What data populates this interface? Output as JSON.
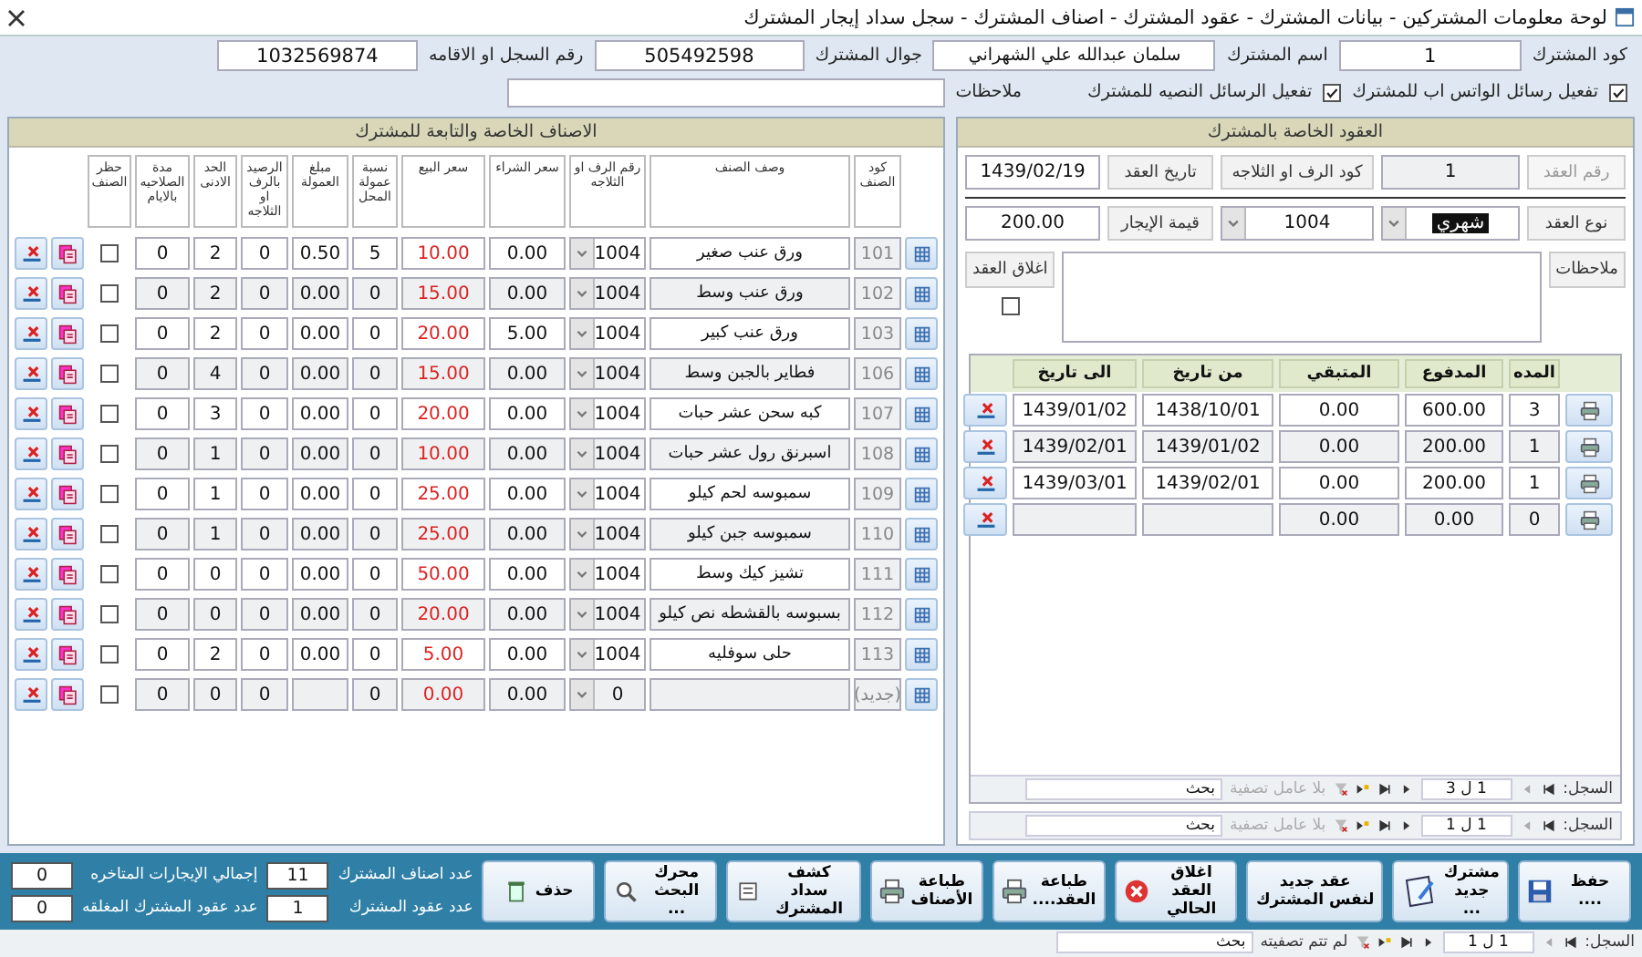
{
  "window": {
    "title": "لوحة معلومات المشتركين - بيانات المشترك - عقود المشترك - اصناف المشترك - سجل سداد إيجار المشترك"
  },
  "subscriber": {
    "fields": [
      {
        "label": "كود المشترك",
        "value": "1"
      },
      {
        "label": "اسم المشترك",
        "value": "سلمان عبدالله علي الشهراني"
      },
      {
        "label": "جوال المشترك",
        "value": "505492598"
      },
      {
        "label": "رقم السجل او الاقامه",
        "value": "1032569874"
      }
    ],
    "whatsapp": {
      "label": "تفعيل رسائل الواتس اب للمشترك",
      "checked": true
    },
    "sms": {
      "label": "تفعيل الرسائل النصيه للمشترك",
      "checked": true
    },
    "notes": {
      "label": "ملاحظات"
    }
  },
  "items_panel": {
    "title": "الاصناف الخاصة والتابعة للمشترك",
    "columns": [
      "كود الصنف",
      "وصف الصنف",
      "رقم الرف او الثلاجه",
      "سعر الشراء",
      "سعر البيع",
      "نسبة عمولة المحل",
      "مبلغ العمولة",
      "الرصيد بالرف او الثلاجه",
      "الحد الادنى",
      "مدة الصلاحيه بالايام",
      "حظر الصنف"
    ],
    "rows": [
      {
        "code": "101",
        "description": "ورق عنب صغير",
        "shelf": "1004",
        "buy_price": "0.00",
        "sell_price": "10.00",
        "commission_pct": "5",
        "commission": "0.50",
        "balance": "0",
        "minimum": "2",
        "shelf_life": "0",
        "blocked": false
      },
      {
        "code": "102",
        "description": "ورق عنب وسط",
        "shelf": "1004",
        "buy_price": "0.00",
        "sell_price": "15.00",
        "commission_pct": "0",
        "commission": "0.00",
        "balance": "0",
        "minimum": "2",
        "shelf_life": "0",
        "blocked": false
      },
      {
        "code": "103",
        "description": "ورق عنب كبير",
        "shelf": "1004",
        "buy_price": "5.00",
        "sell_price": "20.00",
        "commission_pct": "0",
        "commission": "0.00",
        "balance": "0",
        "minimum": "2",
        "shelf_life": "0",
        "blocked": false
      },
      {
        "code": "106",
        "description": "فطاير بالجبن وسط",
        "shelf": "1004",
        "buy_price": "0.00",
        "sell_price": "15.00",
        "commission_pct": "0",
        "commission": "0.00",
        "balance": "0",
        "minimum": "4",
        "shelf_life": "0",
        "blocked": false
      },
      {
        "code": "107",
        "description": "كبه سحن عشر حبات",
        "shelf": "1004",
        "buy_price": "0.00",
        "sell_price": "20.00",
        "commission_pct": "0",
        "commission": "0.00",
        "balance": "0",
        "minimum": "3",
        "shelf_life": "0",
        "blocked": false
      },
      {
        "code": "108",
        "description": "اسبرنق رول عشر حبات",
        "shelf": "1004",
        "buy_price": "0.00",
        "sell_price": "10.00",
        "commission_pct": "0",
        "commission": "0.00",
        "balance": "0",
        "minimum": "1",
        "shelf_life": "0",
        "blocked": false
      },
      {
        "code": "109",
        "description": "سمبوسه لحم كيلو",
        "shelf": "1004",
        "buy_price": "0.00",
        "sell_price": "25.00",
        "commission_pct": "0",
        "commission": "0.00",
        "balance": "0",
        "minimum": "1",
        "shelf_life": "0",
        "blocked": false
      },
      {
        "code": "110",
        "description": "سمبوسه جبن كيلو",
        "shelf": "1004",
        "buy_price": "0.00",
        "sell_price": "25.00",
        "commission_pct": "0",
        "commission": "0.00",
        "balance": "0",
        "minimum": "1",
        "shelf_life": "0",
        "blocked": false
      },
      {
        "code": "111",
        "description": "تشيز كيك وسط",
        "shelf": "1004",
        "buy_price": "0.00",
        "sell_price": "50.00",
        "commission_pct": "0",
        "commission": "0.00",
        "balance": "0",
        "minimum": "0",
        "shelf_life": "0",
        "blocked": false
      },
      {
        "code": "112",
        "description": "بسبوسه بالقشطه نص كيلو",
        "shelf": "1004",
        "buy_price": "0.00",
        "sell_price": "20.00",
        "commission_pct": "0",
        "commission": "0.00",
        "balance": "0",
        "minimum": "0",
        "shelf_life": "0",
        "blocked": false
      },
      {
        "code": "113",
        "description": "حلى سوفليه",
        "shelf": "1004",
        "buy_price": "0.00",
        "sell_price": "5.00",
        "commission_pct": "0",
        "commission": "0.00",
        "balance": "0",
        "minimum": "2",
        "shelf_life": "0",
        "blocked": false
      },
      {
        "code": "(جديد)",
        "shelf": "0",
        "buy_price": "0.00",
        "sell_price": "0.00",
        "commission_pct": "0",
        "balance": "0",
        "minimum": "0",
        "shelf_life": "0",
        "blocked": false
      }
    ]
  },
  "contracts_panel": {
    "title": "العقود الخاصة بالمشترك",
    "contract_no": {
      "label": "رقم العقد",
      "value": "1"
    },
    "shelf_code": {
      "label": "كود الرف او الثلاجه",
      "value": "1004"
    },
    "date": {
      "label": "تاريخ العقد",
      "value": "1439/02/19"
    },
    "type": {
      "label": "نوع العقد",
      "value": "شهري"
    },
    "rent": {
      "label": "قيمة الإيجار",
      "value": "200.00"
    },
    "notes": {
      "label": "ملاحظات"
    },
    "close_contract": {
      "label": "اغلاق العقد",
      "checked": false
    },
    "payments": {
      "columns": [
        "المده",
        "المدفوع",
        "المتبقي",
        "من تاريخ",
        "الى تاريخ"
      ],
      "rows": [
        {
          "months": "3",
          "paid": "600.00",
          "remaining": "0.00",
          "from": "1438/10/01",
          "to": "1439/01/02"
        },
        {
          "months": "1",
          "paid": "200.00",
          "remaining": "0.00",
          "from": "1439/01/02",
          "to": "1439/02/01"
        },
        {
          "months": "1",
          "paid": "200.00",
          "remaining": "0.00",
          "from": "1439/02/01",
          "to": "1439/03/01"
        },
        {
          "months": "0",
          "paid": "0.00",
          "remaining": "0.00"
        }
      ],
      "navigator": {
        "label": "السجل:",
        "position": "1 ل 3",
        "filter": "بلا عامل تصفية",
        "search": "بحث"
      }
    },
    "navigator": {
      "label": "السجل:",
      "position": "1 ل 1",
      "filter": "بلا عامل تصفية",
      "search": "بحث"
    }
  },
  "toolbar": {
    "buttons": [
      {
        "kind": "save",
        "label": "حفظ ...."
      },
      {
        "kind": "new_subscriber",
        "label": "مشترك جديد ..."
      },
      {
        "kind": "new_contract",
        "label": "عقد جديد لنفس المشترك"
      },
      {
        "kind": "close",
        "label": "اغلاق العقد الحالي"
      },
      {
        "kind": "print_contract",
        "label": "طباعة العقد...."
      },
      {
        "kind": "print_items",
        "label": "طباعة الأصناف"
      },
      {
        "kind": "statement",
        "label": "كشف سداد المشترك"
      },
      {
        "kind": "search",
        "label": "محرك البحث ..."
      },
      {
        "kind": "delete",
        "label": "حذف"
      }
    ],
    "counters": [
      {
        "label": "عدد اصناف المشترك",
        "value": "11"
      },
      {
        "label": "إجمالي الإيجارات المتاخره",
        "value": "0"
      },
      {
        "label": "عدد عقود المشترك",
        "value": "1"
      },
      {
        "label": "عدد عقود المشترك المغلقه",
        "value": "0"
      }
    ]
  },
  "status_bar": {
    "label": "السجل:",
    "position": "1 ل 1",
    "filter": "لم تتم تصفيته",
    "search": "بحث"
  }
}
